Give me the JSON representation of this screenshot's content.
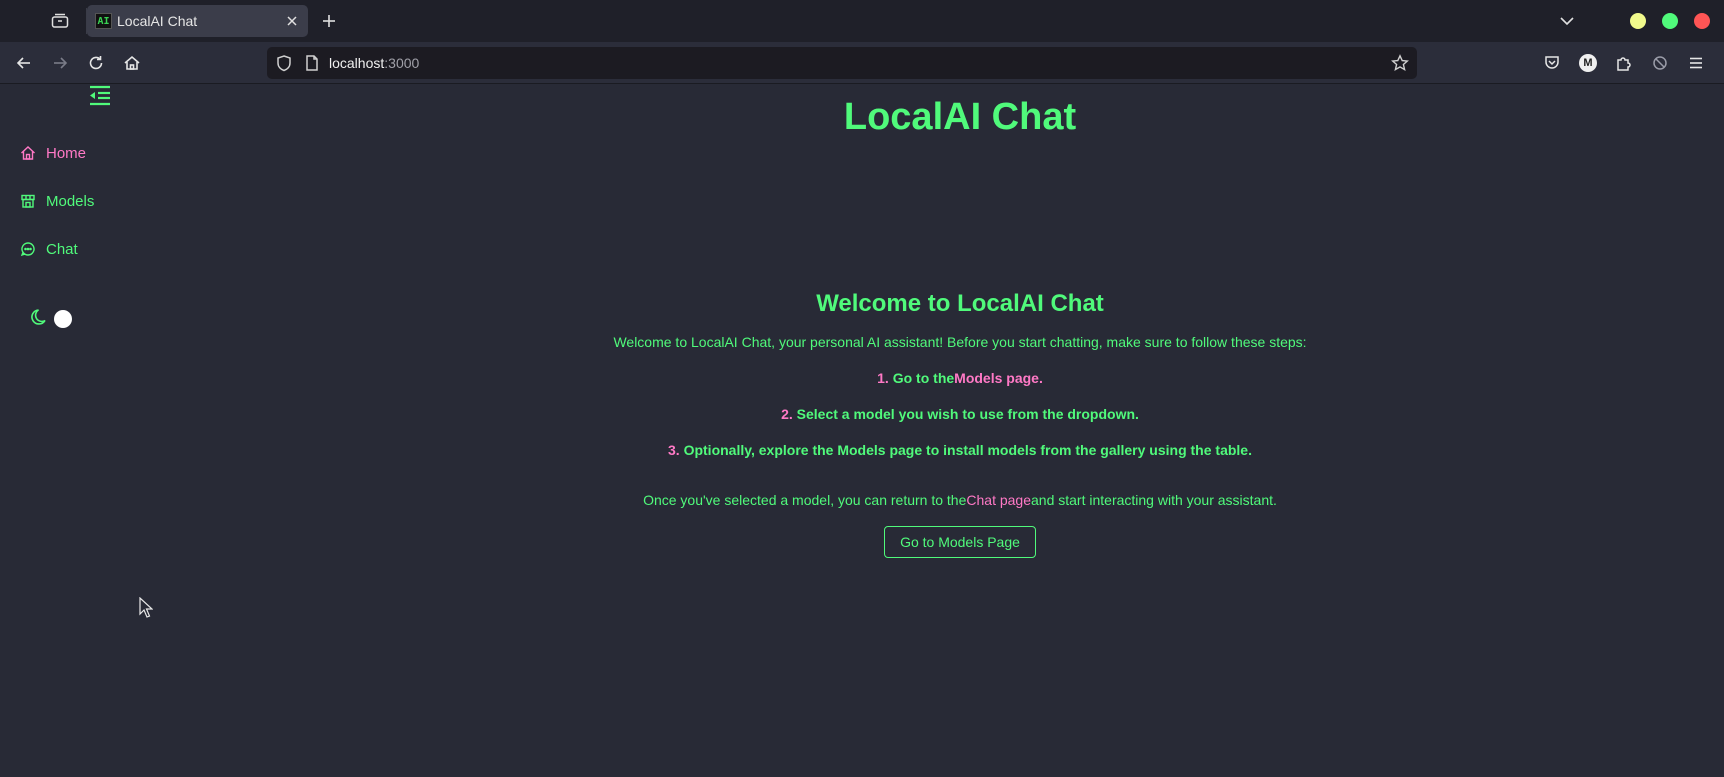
{
  "browser": {
    "tab_title": "LocalAI Chat",
    "favicon_text": "AI",
    "url_host": "localhost",
    "url_port": ":3000",
    "profile_initial": "M",
    "window_controls": {
      "minimize": "#f1fa8c",
      "maximize": "#50fa7b",
      "close": "#ff5555"
    }
  },
  "sidebar": {
    "items": [
      {
        "label": "Home",
        "icon": "home-icon",
        "active": true
      },
      {
        "label": "Models",
        "icon": "store-icon",
        "active": false
      },
      {
        "label": "Chat",
        "icon": "chat-bubble-icon",
        "active": false
      }
    ],
    "theme_toggle": {
      "icon": "moon-icon",
      "state": "dark"
    }
  },
  "main": {
    "app_title": "LocalAI Chat",
    "welcome_heading": "Welcome to LocalAI Chat",
    "intro": "Welcome to LocalAI Chat, your personal AI assistant! Before you start chatting, make sure to follow these steps:",
    "steps": [
      {
        "num": "1.",
        "text_before": " Go to the",
        "link": "Models page",
        "text_after": "."
      },
      {
        "num": "2.",
        "text": " Select a model you wish to use from the dropdown."
      },
      {
        "num": "3.",
        "text": " Optionally, explore the Models page to install models from the gallery using the table."
      }
    ],
    "outro_before": "Once you've selected a model, you can return to the",
    "outro_link": "Chat page",
    "outro_after": "and start interacting with your assistant.",
    "cta_button": "Go to Models Page"
  },
  "colors": {
    "background": "#282a36",
    "accent_green": "#50fa7b",
    "accent_pink": "#ff79c6"
  }
}
